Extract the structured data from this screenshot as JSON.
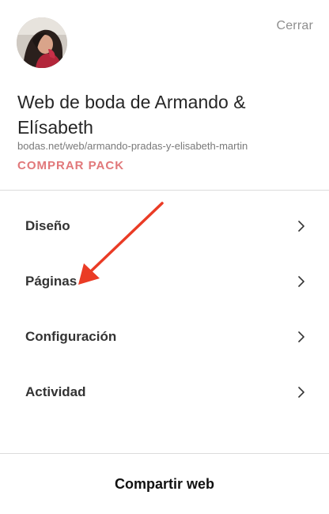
{
  "header": {
    "close_label": "Cerrar",
    "avatar_icon": "profile-photo"
  },
  "site": {
    "title": "Web de boda de Armando & Elísabeth",
    "url": "bodas.net/web/armando-pradas-y-elisabeth-martin",
    "buy_pack_label": "COMPRAR PACK",
    "buy_pack_color": "#e1787a"
  },
  "menu": {
    "items": [
      {
        "label": "Diseño",
        "icon": "chevron-right-icon"
      },
      {
        "label": "Páginas",
        "icon": "chevron-right-icon"
      },
      {
        "label": "Configuración",
        "icon": "chevron-right-icon"
      },
      {
        "label": "Actividad",
        "icon": "chevron-right-icon"
      }
    ]
  },
  "footer": {
    "share_label": "Compartir web"
  },
  "annotation": {
    "arrow_color": "#ea3b25",
    "target": "Páginas"
  }
}
